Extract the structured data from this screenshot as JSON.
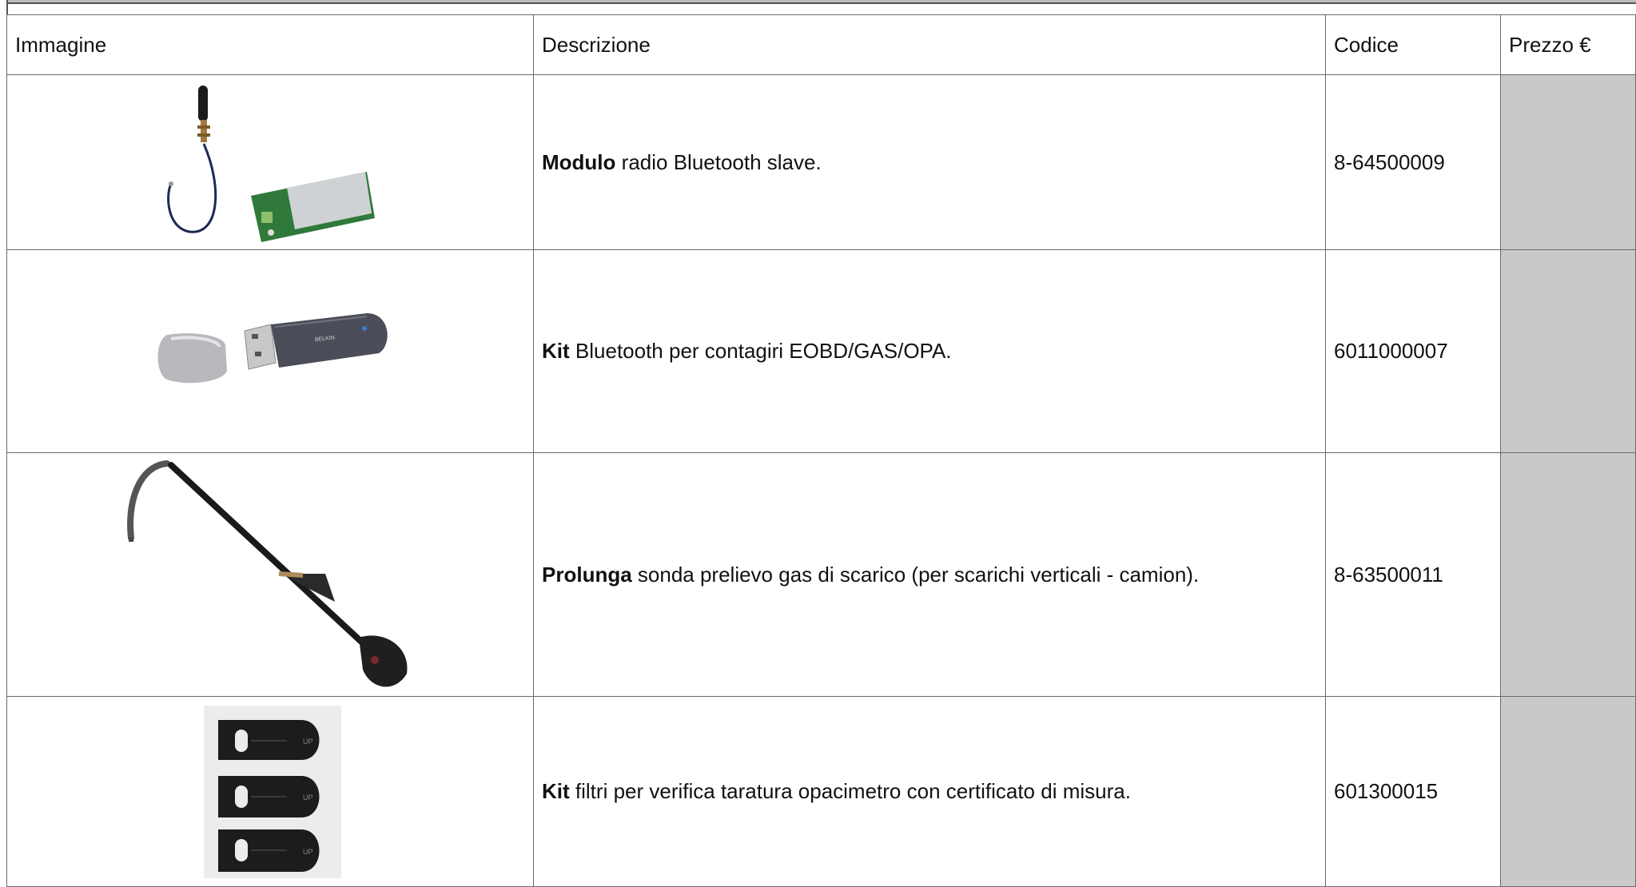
{
  "table": {
    "headers": {
      "image": "Immagine",
      "description": "Descrizione",
      "code": "Codice",
      "price": "Prezzo €"
    },
    "rows": [
      {
        "image_icon": "bluetooth-module-with-antenna",
        "desc_bold": "Modulo",
        "desc_rest": "radio Bluetooth slave.",
        "code": "8-64500009",
        "price": ""
      },
      {
        "image_icon": "usb-bluetooth-dongle",
        "brand_text": "BELKIN",
        "desc_bold": "Kit",
        "desc_rest": "Bluetooth per contagiri EOBD/GAS/OPA.",
        "code": "6011000007",
        "price": ""
      },
      {
        "image_icon": "exhaust-probe-extension",
        "desc_bold": "Prolunga",
        "desc_rest": "sonda prelievo gas di scarico (per scarichi verticali - camion).",
        "code": "8-63500011",
        "price": ""
      },
      {
        "image_icon": "opacimeter-filter-kit",
        "filter_marks": [
          "UP",
          "UP",
          "UP"
        ],
        "desc_bold": "Kit",
        "desc_rest": "filtri per verifica taratura opacimetro con certificato di misura.",
        "code": "601300015",
        "price": ""
      }
    ]
  },
  "colors": {
    "price_cell_bg": "#c9c9c9",
    "border": "#6a6a6a"
  }
}
